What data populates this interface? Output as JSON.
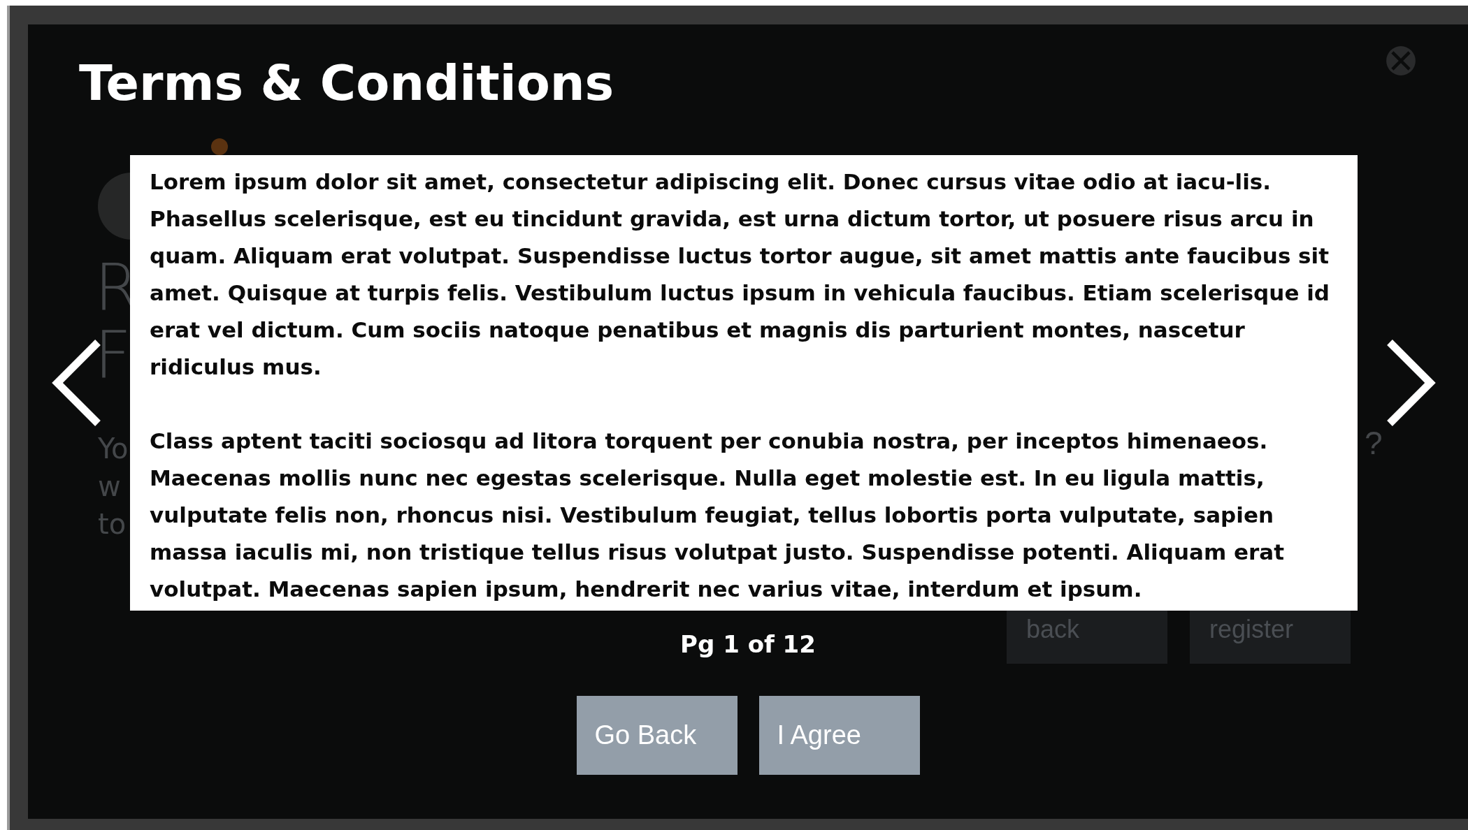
{
  "background_screen": {
    "heading_lines": [
      "R",
      "F"
    ],
    "body_lines": [
      "Yo",
      "w",
      "to"
    ],
    "trailing_mark": "?",
    "buttons": [
      "back",
      "register"
    ]
  },
  "dialog": {
    "title": "Terms & Conditions",
    "paragraphs": [
      "Lorem ipsum dolor sit amet, consectetur adipiscing elit. Donec cursus vitae odio at iacu-lis. Phasellus scelerisque, est eu tincidunt gravida, est urna dictum tortor, ut posuere risus arcu in quam. Aliquam erat volutpat. Suspendisse luctus tortor augue, sit amet mattis ante faucibus sit amet. Quisque at turpis felis. Vestibulum luctus ipsum in vehicula faucibus. Etiam scelerisque id erat vel dictum. Cum sociis natoque penatibus et magnis dis parturient montes, nascetur ridiculus mus.",
      "Class aptent taciti sociosqu ad litora torquent per conubia nostra, per inceptos himenaeos. Maecenas mollis nunc nec egestas scelerisque. Nulla eget molestie est. In eu ligula mattis, vulputate felis non, rhoncus nisi. Vestibulum feugiat, tellus lobortis porta vulputate, sapien massa iaculis mi, non tristique tellus risus volutpat justo. Suspendisse potenti. Aliquam erat volutpat. Maecenas sapien ipsum, hendrerit nec varius vitae, interdum et ipsum."
    ],
    "page_indicator": "Pg 1 of 12",
    "buttons": [
      "Go Back",
      "I Agree"
    ]
  }
}
